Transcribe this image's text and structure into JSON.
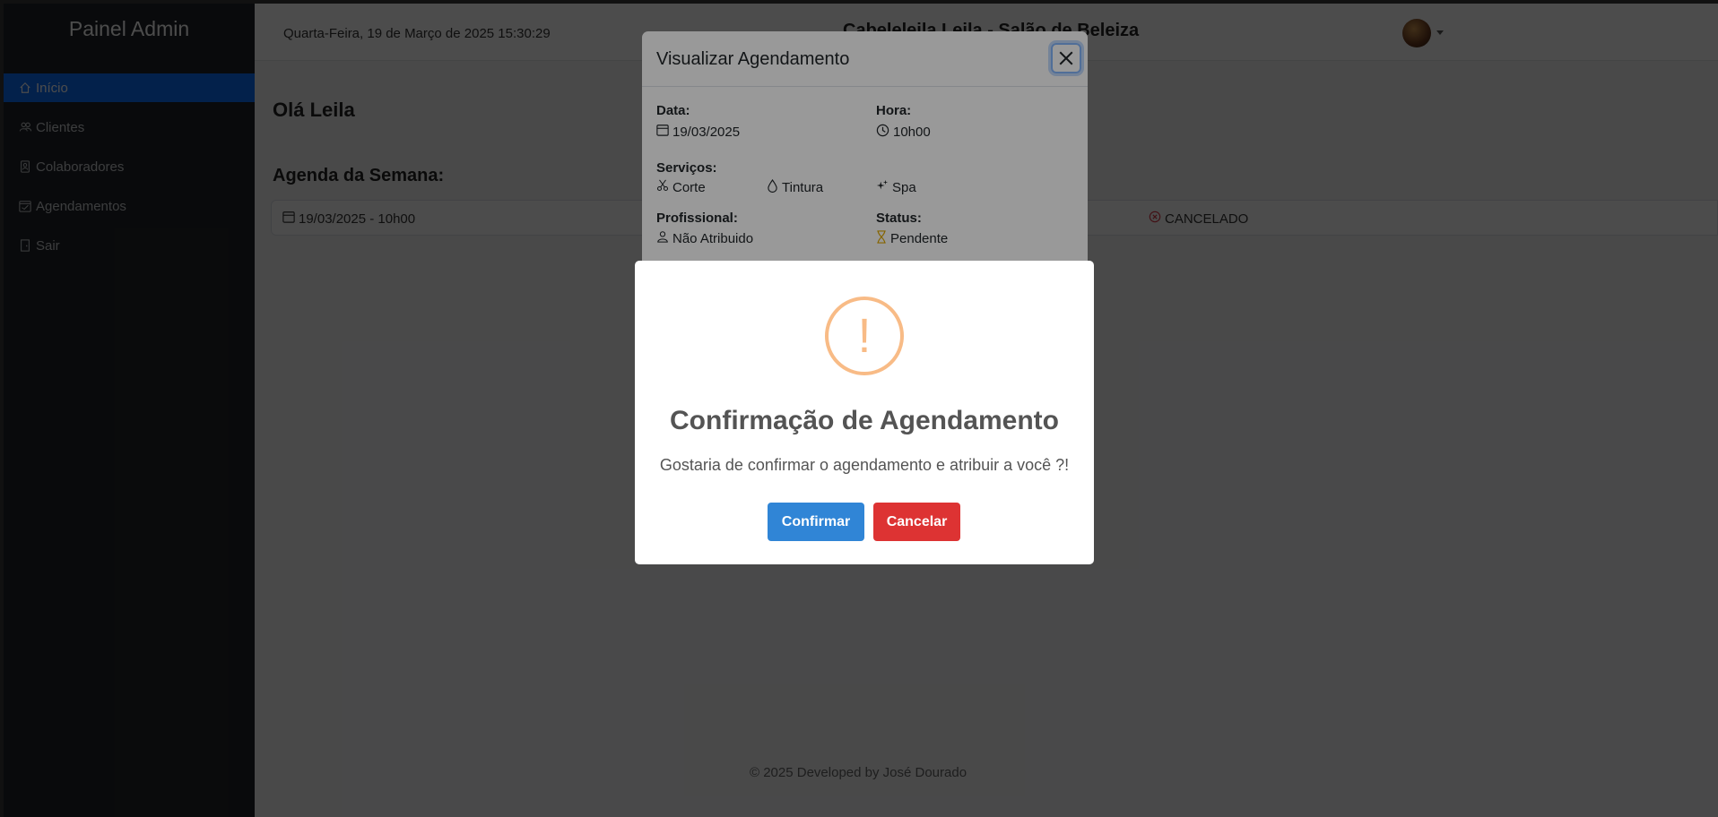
{
  "sidebar": {
    "brand": "Painel Admin",
    "items": [
      {
        "label": "Início",
        "icon": "home-icon"
      },
      {
        "label": "Clientes",
        "icon": "users-icon"
      },
      {
        "label": "Colaboradores",
        "icon": "badge-icon"
      },
      {
        "label": "Agendamentos",
        "icon": "calendar-check-icon"
      },
      {
        "label": "Sair",
        "icon": "door-icon"
      }
    ]
  },
  "header": {
    "datetime": "Quarta-Feira, 19 de Março de 2025 15:30:29",
    "title": "Cabeleleila Leila - Salão de Beleiza"
  },
  "main": {
    "greeting": "Olá Leila",
    "week_title": "Agenda da Semana:",
    "appointment": {
      "datetime": "19/03/2025 - 10h00",
      "status": "CANCELADO"
    }
  },
  "footer": {
    "text": "© 2025 Developed by José Dourado"
  },
  "view_modal": {
    "title": "Visualizar Agendamento",
    "date_label": "Data:",
    "date_value": "19/03/2025",
    "time_label": "Hora:",
    "time_value": "10h00",
    "services_label": "Serviços:",
    "services": [
      "Corte",
      "Tintura",
      "Spa"
    ],
    "professional_label": "Profissional:",
    "professional_value": "Não Atribuido",
    "status_label": "Status:",
    "status_value": "Pendente"
  },
  "confirm_dialog": {
    "icon": "!",
    "title": "Confirmação de Agendamento",
    "text": "Gostaria de confirmar o agendamento e atribuir a você ?!",
    "confirm_label": "Confirmar",
    "cancel_label": "Cancelar"
  },
  "colors": {
    "sidebar_bg": "#212529",
    "active_nav": "#0d6efd",
    "warning": "#f8bb86",
    "confirm_button": "#3085d6",
    "cancel_button": "#dd3333"
  }
}
